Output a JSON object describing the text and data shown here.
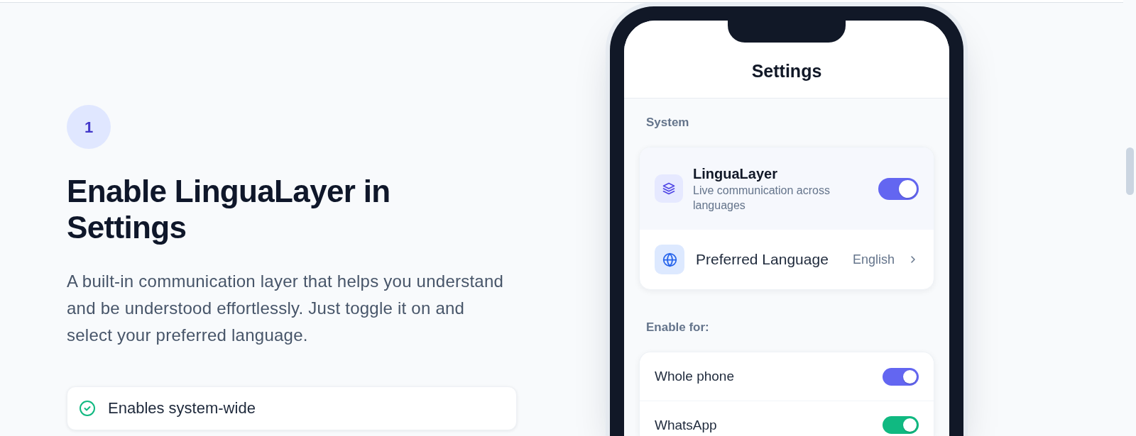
{
  "step": {
    "number": "1",
    "title": "Enable LinguaLayer in Settings",
    "description": "A built-in communication layer that helps you understand and be understood effortlessly. Just toggle it on and select your preferred language.",
    "features": [
      "Enables system-wide"
    ]
  },
  "phone": {
    "title": "Settings",
    "sections": [
      {
        "label": "System",
        "rows": [
          {
            "kind": "feature",
            "title": "LinguaLayer",
            "subtitle": "Live communication across languages",
            "on": true,
            "color": "#6366f1"
          },
          {
            "kind": "link",
            "label": "Preferred Language",
            "value": "English"
          }
        ]
      },
      {
        "label": "Enable for:",
        "rows": [
          {
            "kind": "toggle",
            "label": "Whole phone",
            "on": true,
            "color": "#6366f1"
          },
          {
            "kind": "toggle",
            "label": "WhatsApp",
            "on": true,
            "color": "#10b981"
          }
        ]
      }
    ]
  }
}
